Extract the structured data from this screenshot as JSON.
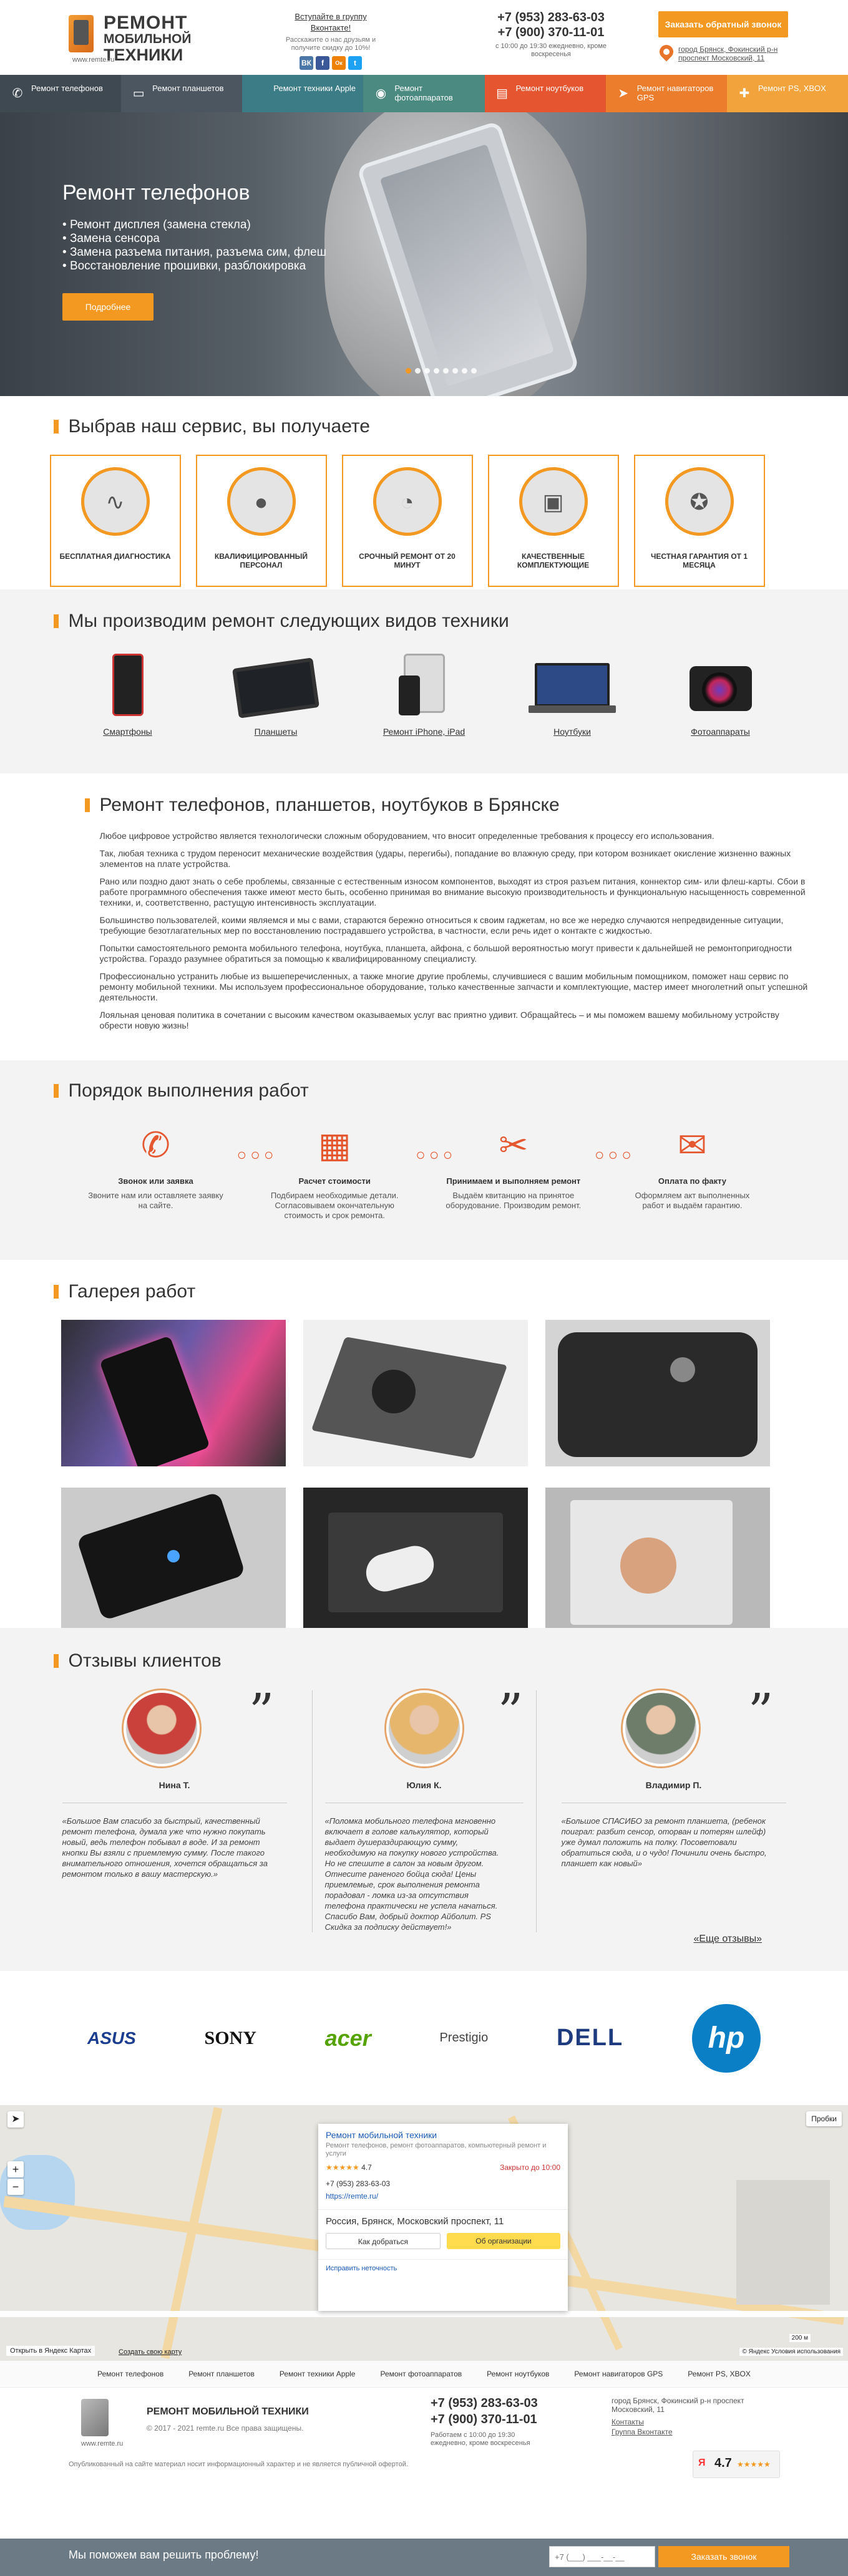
{
  "header": {
    "logo_line1": "РЕМОНТ",
    "logo_line2": "МОБИЛЬНОЙ",
    "logo_line3": "ТЕХНИКИ",
    "logo_url": "www.remte.ru",
    "vk_join": "Вступайте в группу Вконтакте!",
    "vk_promo": "Расскажите о нас друзьям и получите скидку до 10%!",
    "social": [
      "ВК",
      "f",
      "Ок",
      "t"
    ],
    "phone1": "+7 (953) 283-63-03",
    "phone2": "+7 (900) 370-11-01",
    "hours": "с 10:00 до 19:30 ежедневно, кроме воскресенья",
    "callback_label": "Заказать обратный звонок",
    "address": "город Брянск, Фокинский р-н проспект Московский, 11"
  },
  "nav": [
    {
      "label": "Ремонт телефонов",
      "icon": "phone-icon",
      "color": "#3f4952"
    },
    {
      "label": "Ремонт планшетов",
      "icon": "tablet-icon",
      "color": "#4b5660"
    },
    {
      "label": "Ремонт техники Apple",
      "icon": "apple-icon",
      "color": "#3c7c86"
    },
    {
      "label": "Ремонт фотоаппаратов",
      "icon": "camera-icon",
      "color": "#4a8a80"
    },
    {
      "label": "Ремонт ноутбуков",
      "icon": "laptop-icon",
      "color": "#e5552f"
    },
    {
      "label": "Ремонт навигаторов GPS",
      "icon": "gps-icon",
      "color": "#ec7d2c"
    },
    {
      "label": "Ремонт PS, XBOX",
      "icon": "gamepad-icon",
      "color": "#f3a33c"
    }
  ],
  "hero": {
    "title": "Ремонт телефонов",
    "bullets": [
      "Ремонт дисплея (замена стекла)",
      "Замена сенсора",
      "Замена разъема питания, разъема сим, флеш",
      "Восстановление прошивки, разблокировка"
    ],
    "button": "Подробнее",
    "slide_count": 8,
    "active_slide": 1
  },
  "features": {
    "title": "Выбрав наш сервис, вы получаете",
    "items": [
      {
        "label": "БЕСПЛАТНАЯ ДИАГНОСТИКА",
        "icon": "pulse-icon"
      },
      {
        "label": "КВАЛИФИЦИРОВАННЫЙ ПЕРСОНАЛ",
        "icon": "person-icon"
      },
      {
        "label": "СРОЧНЫЙ РЕМОНТ ОТ 20 МИНУТ",
        "icon": "clock-icon"
      },
      {
        "label": "КАЧЕСТВЕННЫЕ КОМПЛЕКТУЮЩИЕ",
        "icon": "chip-icon"
      },
      {
        "label": "ЧЕСТНАЯ ГАРАНТИЯ ОТ 1 МЕСЯЦА",
        "icon": "award-icon"
      }
    ]
  },
  "types": {
    "title": "Мы производим ремонт следующих видов техники",
    "items": [
      "Смартфоны",
      "Планшеты",
      "Ремонт iPhone, iPad",
      "Ноутбуки",
      "Фотоаппараты"
    ]
  },
  "about": {
    "title": "Ремонт телефонов, планшетов, ноутбуков в Брянске",
    "paragraphs": [
      "Любое цифровое устройство является технологически сложным оборудованием, что вносит определенные требования к процессу его использования.",
      "Так, любая техника с трудом переносит механические воздействия (удары, перегибы), попадание во влажную среду, при котором возникает окисление жизненно важных элементов на плате устройства.",
      "Рано или поздно дают знать о себе проблемы, связанные с естественным износом компонентов, выходят из строя разъем питания, коннектор сим- или флеш-карты. Сбои в работе программного обеспечения также имеют место быть, особенно принимая во внимание высокую производительность и функциональную насыщенность современной техники, и, соответственно, растущую интенсивность эксплуатации.",
      "Большинство пользователей, коими являемся и мы с вами, стараются бережно относиться к своим гаджетам, но все же нередко случаются непредвиденные ситуации, требующие безотлагательных мер по восстановлению пострадавшего устройства, в частности, если речь идет о контакте с жидкостью.",
      "Попытки самостоятельного ремонта мобильного телефона, ноутбука, планшета, айфона, с большой вероятностью могут привести к дальнейшей не ремонтопригодности устройства. Гораздо разумнее обратиться за помощью к квалифицированному специалисту.",
      "Профессионально устранить любые из вышеперечисленных, а также многие другие проблемы, случившиеся с вашим мобильным помощником, поможет наш сервис по ремонту мобильной техники. Мы используем профессиональное оборудование, только качественные запчасти и комплектующие, мастер имеет многолетний опыт успешной деятельности.",
      "Лояльная ценовая политика в сочетании с высоким качеством оказываемых услуг вас приятно удивит.  Обращайтесь – и мы поможем вашему мобильному устройству обрести новую жизнь!"
    ]
  },
  "process": {
    "title": "Порядок выполнения работ",
    "steps": [
      {
        "title": "Звонок или заявка",
        "desc": "Звоните нам или оставляете заявку на сайте.",
        "icon": "phone-call-icon"
      },
      {
        "title": "Расчет стоимости",
        "desc": "Подбираем необходимые детали. Согласовываем окончательную стоимость и срок ремонта.",
        "icon": "calculator-icon"
      },
      {
        "title": "Принимаем и выполняем ремонт",
        "desc": "Выдаём квитанцию на принятое оборудование. Производим ремонт.",
        "icon": "tools-icon"
      },
      {
        "title": "Оплата по факту",
        "desc": "Оформляем акт выполненных работ и выдаём гарантию.",
        "icon": "payment-icon"
      }
    ]
  },
  "gallery": {
    "title": "Галерея работ",
    "count": 6
  },
  "reviews": {
    "title": "Отзывы клиентов",
    "items": [
      {
        "name": "Нина Т.",
        "text": "«Большое Вам спасибо за быстрый, качественный ремонт телефона, думала уже что нужно покупать новый, ведь телефон побывал в воде. И за ремонт кнопки Вы взяли с приемлемую сумму. После такого внимательного отношения, хочется обращаться за ремонтом только в вашу мастерскую.»"
      },
      {
        "name": "Юлия К.",
        "text": "«Поломка мобильного телефона мгновенно включает в голове калькулятор, который выдает душераздирающую сумму, необходимую на покупку нового устройства. Но не спешите в салон за новым другом. Отнесите раненого бойца сюда! Цены приемлемые, срок выполнения ремонта порадовал - ломка из-за отсутствия телефона практически не успела начаться.  Спасибо Вам, добрый доктор Айболит. PS Скидка за подписку действует!»"
      },
      {
        "name": "Владимир П.",
        "text": "«Большое СПАСИБО за ремонт планшета, (ребенок поиграл: разбит сенсор, оторван и потерян шлейф) уже думал положить на полку. Посоветовали обратиться сюда, и о чудо! Починили очень быстро, планшет как новый»"
      }
    ],
    "all_link": "«Еще отзывы»"
  },
  "brands": [
    "ASUS",
    "SONY",
    "acer",
    "Prestigio",
    "DELL",
    "hp"
  ],
  "map": {
    "org_title": "Ремонт мобильной техники",
    "org_desc": "Ремонт телефонов, ремонт фотоаппаратов, компьютерный ремонт и услуги",
    "rating": "4.7",
    "status": "Закрыто до 10:00",
    "phone": "+7 (953) 283-63-03",
    "site": "https://remte.ru/",
    "address": "Россия, Брянск, Московский проспект, 11",
    "route_btn": "Как добраться",
    "org_btn": "Об организации",
    "fix_link": "Исправить неточность",
    "open_yandex": "Открыть в Яндекс Картах",
    "create_map": "Создать свою карту",
    "traffic": "Пробки",
    "scale": "200 м",
    "terms": "© Яндекс Условия использования"
  },
  "footer": {
    "nav": [
      "Ремонт телефонов",
      "Ремонт планшетов",
      "Ремонт техники Apple",
      "Ремонт фотоаппаратов",
      "Ремонт ноутбуков",
      "Ремонт навигаторов GPS",
      "Ремонт PS, XBOX"
    ],
    "logo_title": "РЕМОНТ МОБИЛЬНОЙ ТЕХНИКИ",
    "copyright": "© 2017 - 2021 remte.ru Все права защищены.",
    "logo_url": "www.remte.ru",
    "phone1": "+7 (953) 283-63-03",
    "phone2": "+7 (900) 370-11-01",
    "hours": "Работаем с 10:00 до 19:30 ежедневно, кроме воскресенья",
    "address": "город Брянск, Фокинский р-н проспект Московский, 11",
    "contacts": "Контакты",
    "vk_group": "Группа Вконтакте",
    "disclaimer": "Опубликованный на сайте материал носит информационный характер и не является публичной офертой.",
    "ya_rating": "4.7"
  },
  "bottom_bar": {
    "text": "Мы поможем вам решить проблему!",
    "placeholder": "+7 (___) ___-__-__",
    "button": "Заказать звонок"
  }
}
